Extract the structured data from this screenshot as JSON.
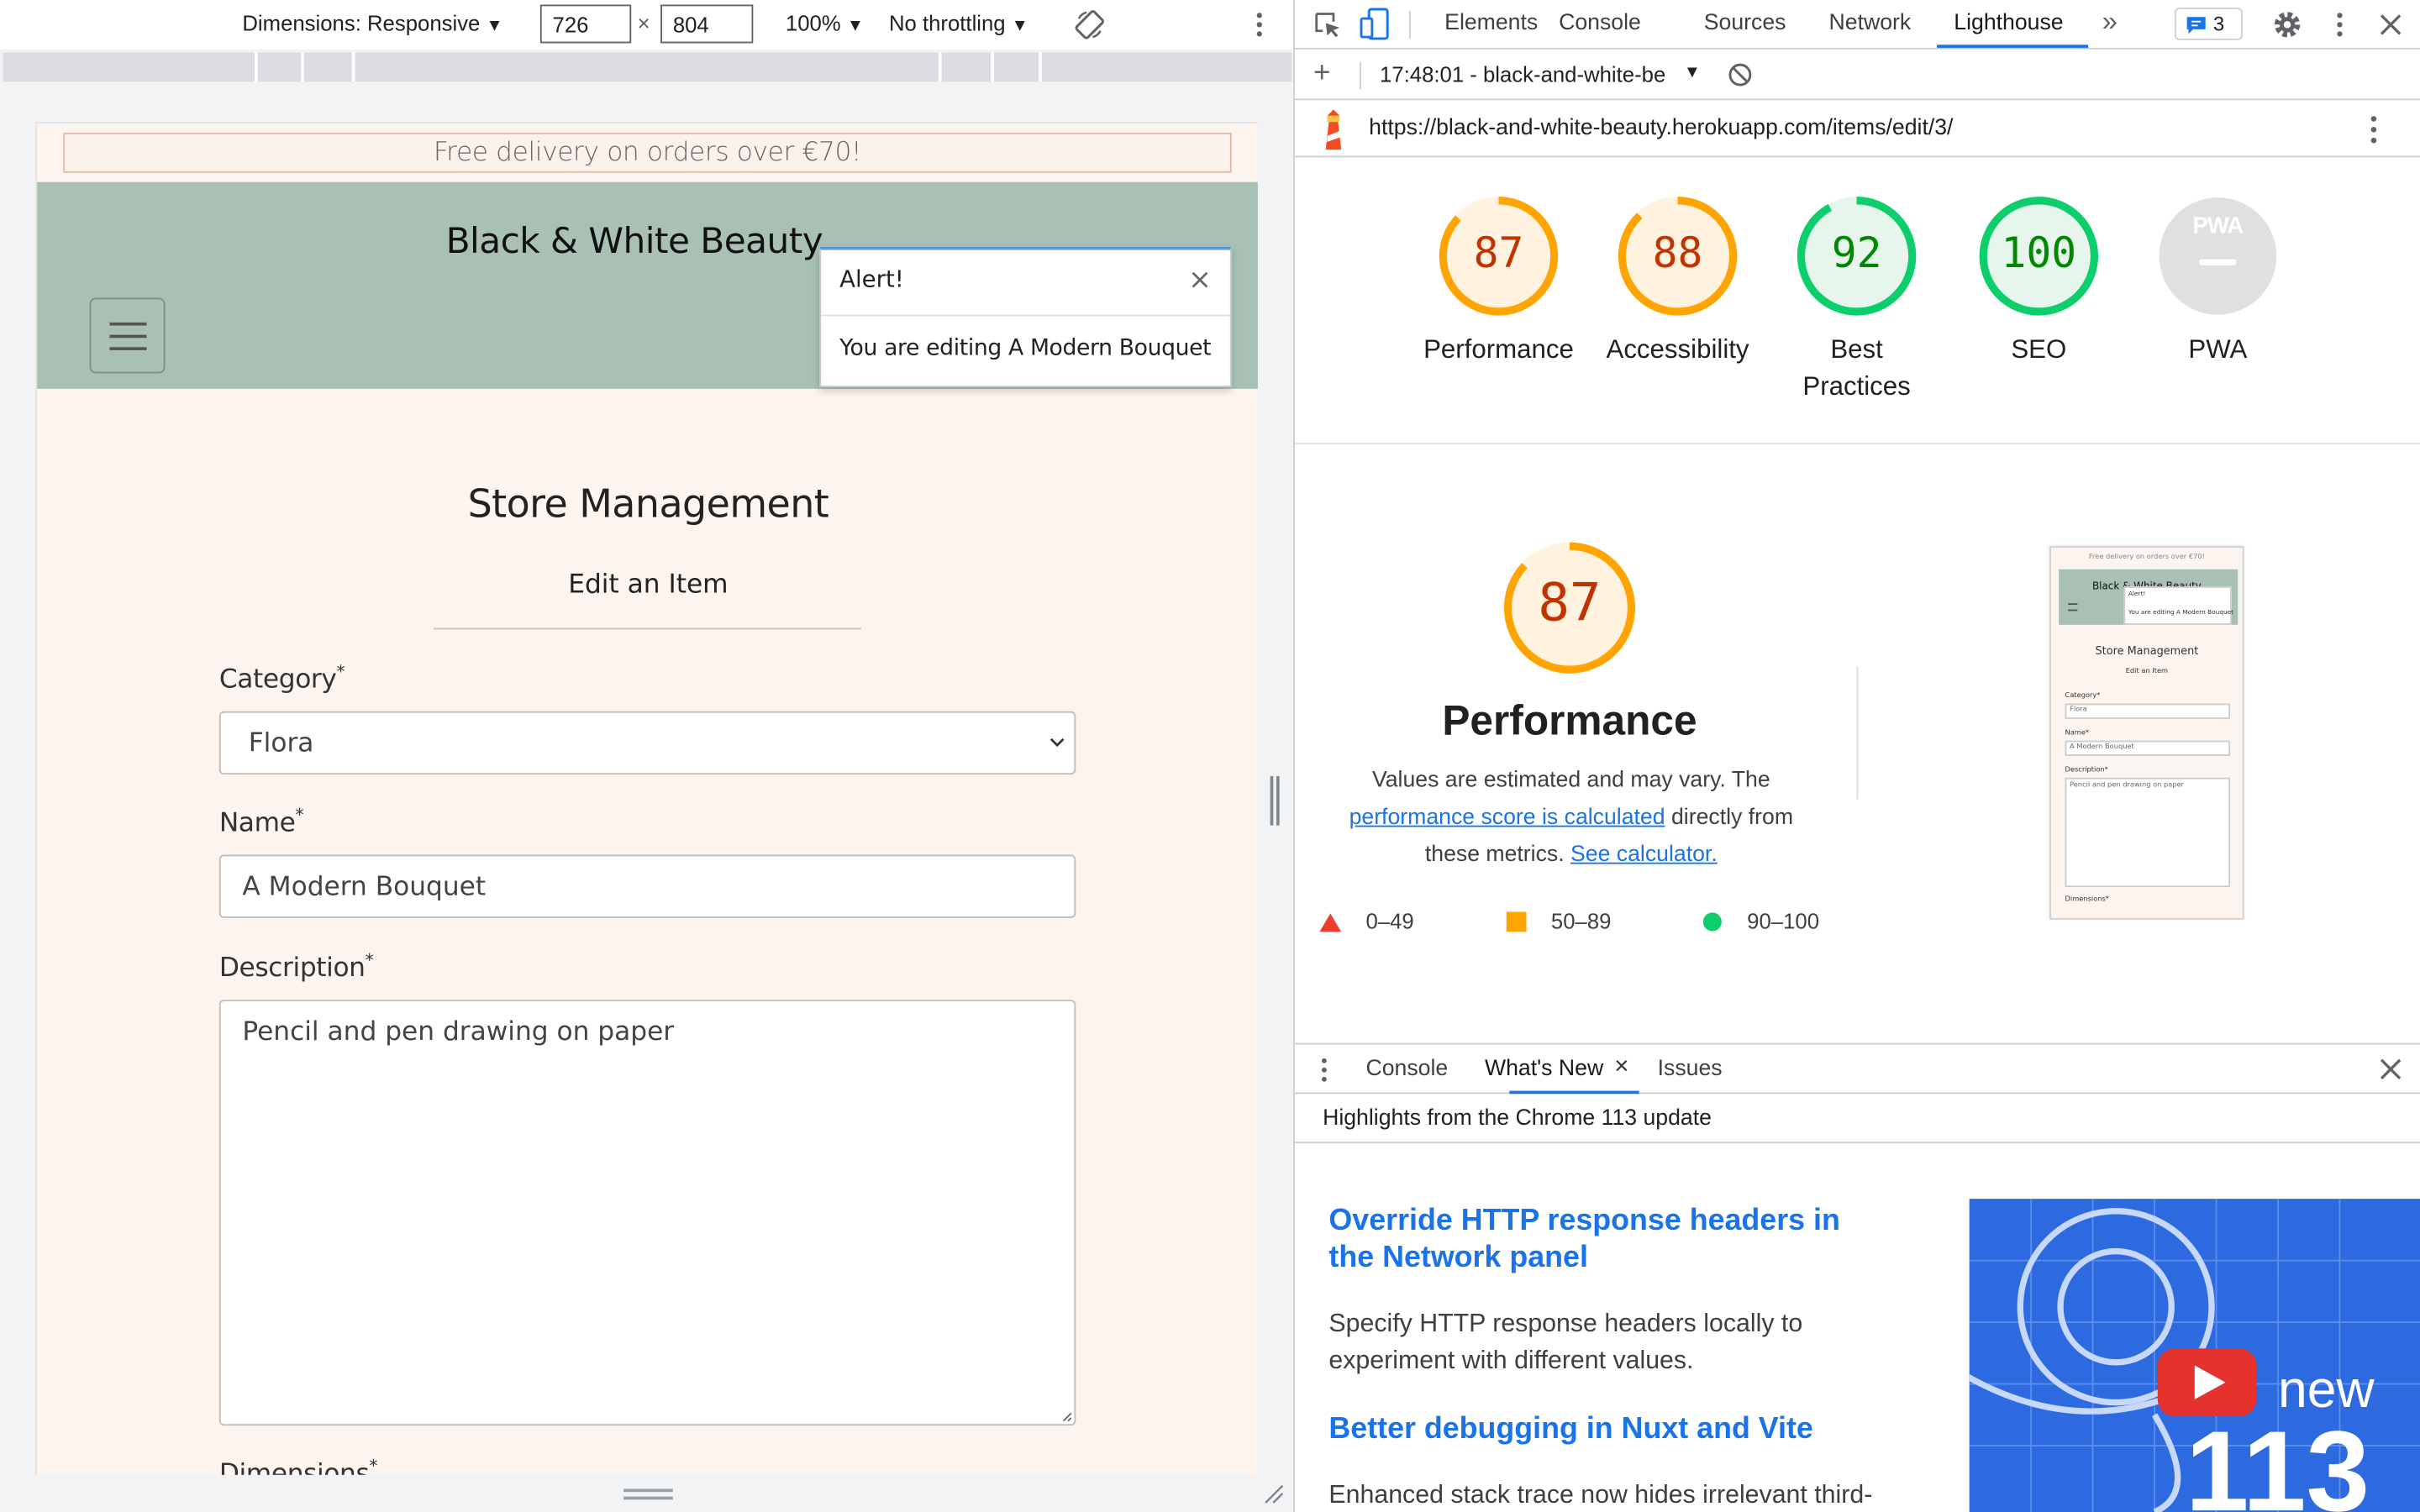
{
  "device_toolbar": {
    "dimensions_label": "Dimensions: Responsive",
    "width": "726",
    "times": "×",
    "height": "804",
    "zoom": "100%",
    "throttling": "No throttling",
    "dropdown_arrow": "▼",
    "menu_icon": "kebab-vertical-icon"
  },
  "site": {
    "delivery_banner": "Free delivery on orders over €70!",
    "brand": "Black & White Beauty",
    "alert": {
      "title": "Alert!",
      "close": "×",
      "message": "You are editing A Modern Bouquet"
    },
    "page_title": "Store Management",
    "page_subtitle": "Edit an Item",
    "form": {
      "category_label": "Category",
      "name_label": "Name",
      "description_label": "Description",
      "dimensions_label": "Dimensions",
      "required_mark": "*",
      "category_value": "Flora",
      "name_value": "A Modern Bouquet",
      "description_value": "Pencil and pen drawing on paper"
    }
  },
  "devtools": {
    "tabs": [
      "Elements",
      "Console",
      "Sources",
      "Network",
      "Lighthouse"
    ],
    "more_tabs": "»",
    "active_tab": "Lighthouse",
    "issues_count": "3",
    "lighthouse_bar": {
      "add": "+",
      "report": "17:48:01 - black-and-white-be"
    },
    "url": "https://black-and-white-beauty.herokuapp.com/items/edit/3/",
    "scores": [
      {
        "value": 87,
        "label": "Performance",
        "color": "#c33300",
        "ring": "#ffa400",
        "bg": "#fff3e0"
      },
      {
        "value": 88,
        "label": "Accessibility",
        "color": "#c33300",
        "ring": "#ffa400",
        "bg": "#fff3e0"
      },
      {
        "value": 92,
        "label": "Best Practices",
        "color": "#080",
        "ring": "#0cce6b",
        "bg": "#e6f6ec"
      },
      {
        "value": 100,
        "label": "SEO",
        "color": "#080",
        "ring": "#0cce6b",
        "bg": "#e6f6ec"
      }
    ],
    "pwa": {
      "badge": "PWA",
      "label": "PWA"
    },
    "performance": {
      "score": "87",
      "title": "Performance",
      "desc_1": "Values are estimated and may vary. The",
      "link_1": "performance score is calculated",
      "desc_2": "directly from",
      "desc_3": "these metrics.",
      "link_2": "See calculator."
    },
    "legend": [
      {
        "range": "0–49",
        "color": "#eb3c2e"
      },
      {
        "range": "50–89",
        "color": "#ffa400"
      },
      {
        "range": "90–100",
        "color": "#0cce6b"
      }
    ],
    "thumbnail": {
      "banner": "Free delivery on orders over €70!",
      "brand": "Black & White Beauty",
      "alert_title": "Alert!",
      "alert_msg": "You are editing A Modern Bouquet",
      "title": "Store Management",
      "subtitle": "Edit an Item",
      "category": "Category*",
      "category_value": "Flora",
      "name": "Name*",
      "name_value": "A Modern Bouquet",
      "description": "Description*",
      "description_value": "Pencil and pen drawing on paper",
      "dimensions": "Dimensions*"
    },
    "drawer": {
      "tabs": [
        "Console",
        "What's New",
        "Issues"
      ],
      "active": "What's New",
      "close": "×",
      "highlights": "Highlights from the Chrome 113 update",
      "items": [
        {
          "heading_1": "Override HTTP response headers in",
          "heading_2": "the Network panel",
          "text_1": "Specify HTTP response headers locally to",
          "text_2": "experiment with different values."
        },
        {
          "heading_1": "Better debugging in Nuxt and Vite",
          "text_1": "Enhanced stack trace now hides irrelevant third-"
        }
      ],
      "video": {
        "word": "new",
        "number": "113"
      }
    }
  }
}
